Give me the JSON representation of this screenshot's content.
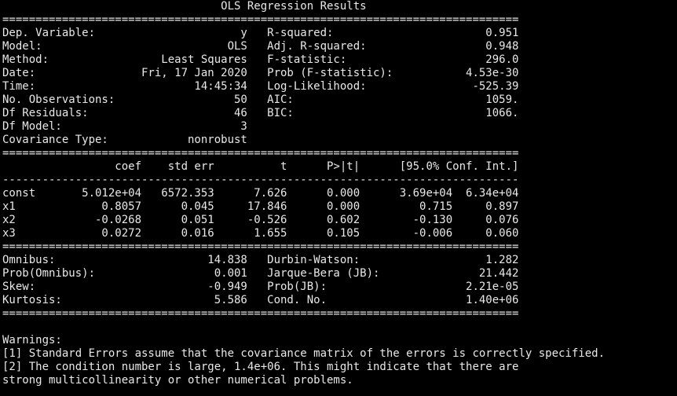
{
  "colors": {
    "background": "#000000",
    "text": "#e8e8e8"
  },
  "terminal": {
    "lines": [
      "                                 OLS Regression Results                            ",
      "==============================================================================",
      "Dep. Variable:                      y   R-squared:                       0.951",
      "Model:                            OLS   Adj. R-squared:                  0.948",
      "Method:                 Least Squares   F-statistic:                     296.0",
      "Date:                Fri, 17 Jan 2020   Prob (F-statistic):           4.53e-30",
      "Time:                        14:45:34   Log-Likelihood:                -525.39",
      "No. Observations:                  50   AIC:                             1059.",
      "Df Residuals:                      46   BIC:                             1066.",
      "Df Model:                           3                                         ",
      "Covariance Type:            nonrobust                                         ",
      "==============================================================================",
      "                 coef    std err          t      P>|t|      [95.0% Conf. Int.]",
      "------------------------------------------------------------------------------",
      "const       5.012e+04   6572.353      7.626      0.000      3.69e+04  6.34e+04",
      "x1             0.8057      0.045     17.846      0.000         0.715     0.897",
      "x2            -0.0268      0.051     -0.526      0.602        -0.130     0.076",
      "x3             0.0272      0.016      1.655      0.105        -0.006     0.060",
      "==============================================================================",
      "Omnibus:                       14.838   Durbin-Watson:                   1.282",
      "Prob(Omnibus):                  0.001   Jarque-Bera (JB):               21.442",
      "Skew:                          -0.949   Prob(JB):                     2.21e-05",
      "Kurtosis:                       5.586   Cond. No.                     1.40e+06",
      "==============================================================================",
      "",
      "Warnings:",
      "[1] Standard Errors assume that the covariance matrix of the errors is correctly specified.",
      "[2] The condition number is large, 1.4e+06. This might indicate that there are",
      "strong multicollinearity or other numerical problems."
    ]
  }
}
